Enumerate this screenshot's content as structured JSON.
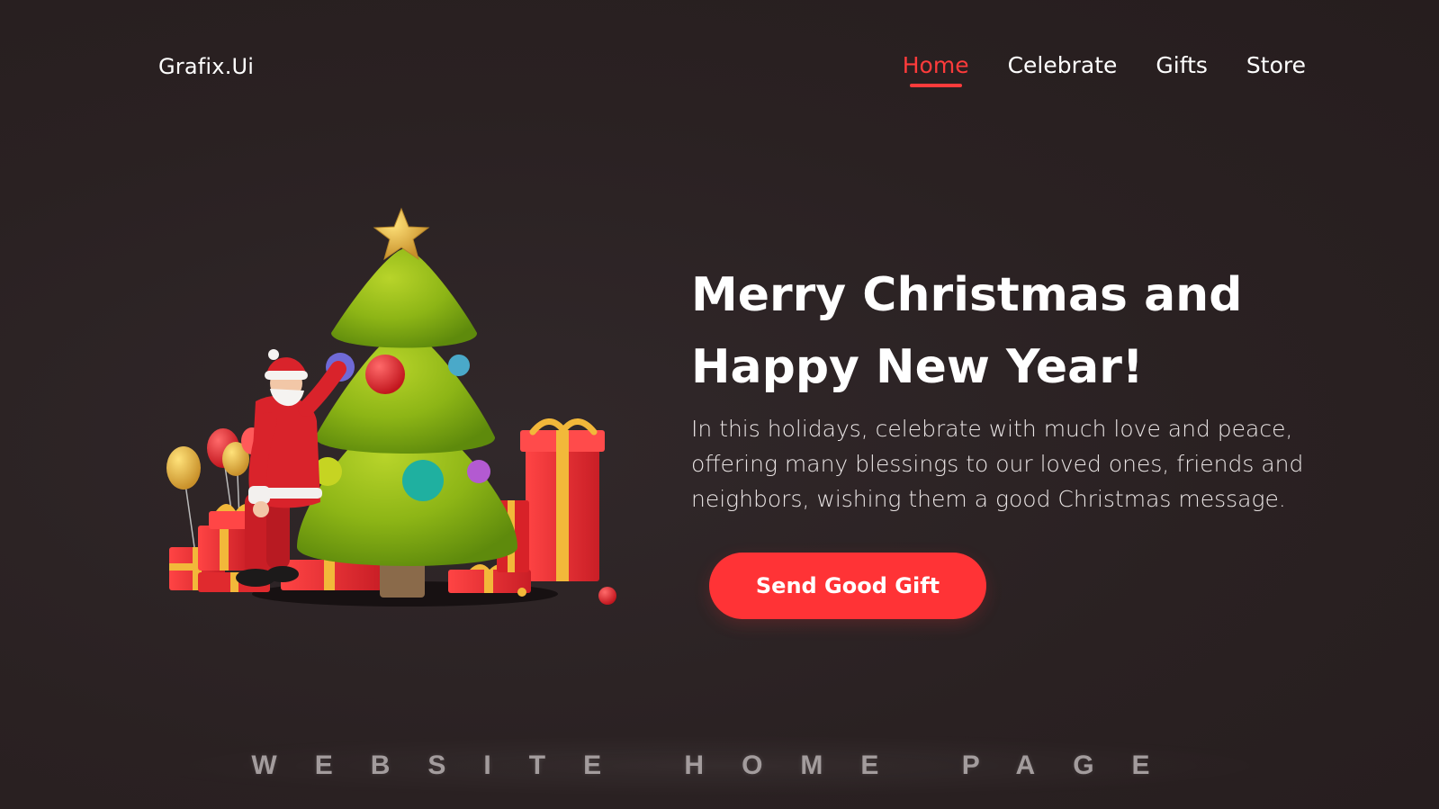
{
  "brand": {
    "logo_text": "Grafix.Ui"
  },
  "nav": {
    "items": [
      {
        "label": "Home",
        "active": true
      },
      {
        "label": "Celebrate",
        "active": false
      },
      {
        "label": "Gifts",
        "active": false
      },
      {
        "label": "Store",
        "active": false
      }
    ]
  },
  "hero": {
    "title_line1": "Merry Christmas and",
    "title_line2": "Happy New Year!",
    "description": "In this holidays, celebrate with much love and peace, offering many blessings to our loved ones, friends and neighbors, wishing them a good Christmas message.",
    "cta_label": "Send Good Gift"
  },
  "illustration": {
    "icon": "christmas-tree-with-santa-and-gifts"
  },
  "footer": {
    "caption": "WEBSITE HOME PAGE"
  },
  "colors": {
    "background": "#2a2122",
    "accent": "#ff3336",
    "text": "#ffffff"
  }
}
